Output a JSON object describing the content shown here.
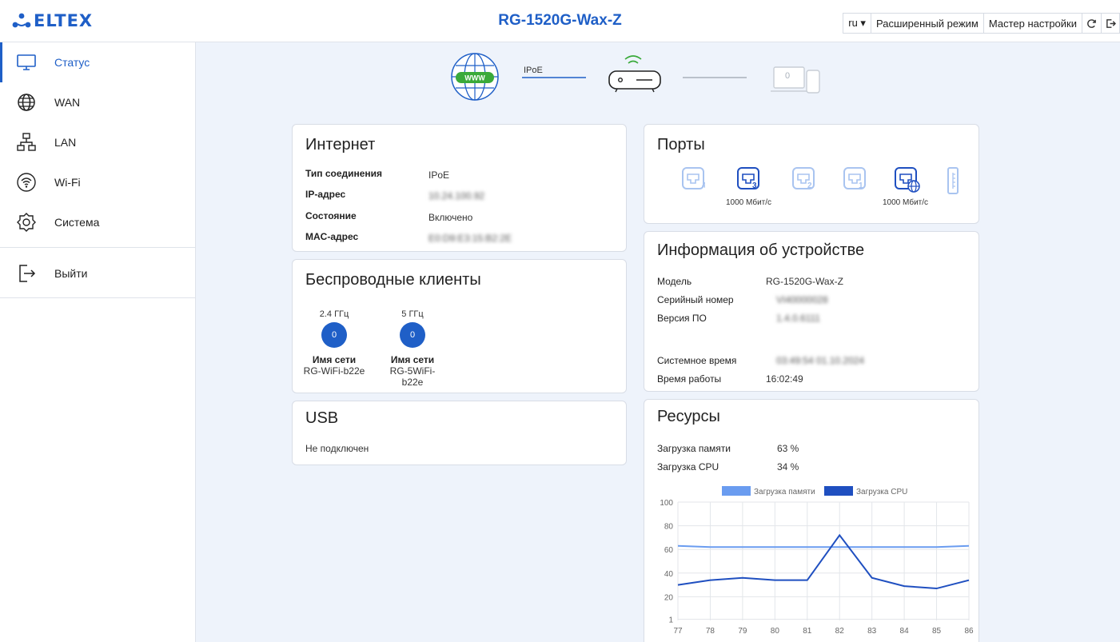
{
  "header": {
    "logo": "ELTEX",
    "title": "RG-1520G-Wax-Z",
    "lang": "ru ▾",
    "advanced_mode": "Расширенный режим",
    "setup_wizard": "Мастер настройки",
    "refresh_icon": "refresh-icon",
    "logout_icon": "logout-icon"
  },
  "sidebar": {
    "items": [
      {
        "label": "Статус",
        "icon": "monitor-icon",
        "active": true
      },
      {
        "label": "WAN",
        "icon": "globe-icon"
      },
      {
        "label": "LAN",
        "icon": "network-icon"
      },
      {
        "label": "Wi-Fi",
        "icon": "wifi-icon"
      },
      {
        "label": "Система",
        "icon": "gear-icon"
      },
      {
        "label": "Выйти",
        "icon": "logout-icon"
      }
    ]
  },
  "topology": {
    "www_label": "WWW",
    "link_label": "IPoE",
    "clients_count": "0"
  },
  "internet": {
    "title": "Интернет",
    "rows": [
      {
        "key": "Тип соединения",
        "value": "IPoE"
      },
      {
        "key": "IP-адрес",
        "value": "10.24.100.92"
      },
      {
        "key": "Состояние",
        "value": "Включено"
      },
      {
        "key": "MAC-адрес",
        "value": "E0:D9:E3:15:B2:2E"
      }
    ]
  },
  "wireless": {
    "title": "Беспроводные клиенты",
    "bands": [
      {
        "band": "2.4 ГГц",
        "count": "0",
        "net_label": "Имя сети",
        "ssid": "RG-WiFi-b22e"
      },
      {
        "band": "5 ГГц",
        "count": "0",
        "net_label": "Имя сети",
        "ssid": "RG-5WiFi-b22e"
      }
    ]
  },
  "usb": {
    "title": "USB",
    "status": "Не подключен"
  },
  "ports": {
    "title": "Порты",
    "items": [
      {
        "num": "4",
        "active": false,
        "speed": ""
      },
      {
        "num": "3",
        "active": true,
        "speed": "1000 Мбит/с"
      },
      {
        "num": "2",
        "active": false,
        "speed": ""
      },
      {
        "num": "1",
        "active": false,
        "speed": ""
      },
      {
        "num": "WAN",
        "active": true,
        "speed": "1000 Мбит/с"
      }
    ]
  },
  "device": {
    "title": "Информация об устройстве",
    "rows": [
      {
        "key": "Модель",
        "value": "RG-1520G-Wax-Z"
      },
      {
        "key": "Серийный номер",
        "value": "VI40000028"
      },
      {
        "key": "Версия ПО",
        "value": "1.4.0.6111"
      },
      {
        "key": "Системное время",
        "value": "03:49:54 01.10.2024"
      },
      {
        "key": "Время работы",
        "value": "16:02:49"
      }
    ]
  },
  "resources": {
    "title": "Ресурсы",
    "rows": [
      {
        "key": "Загрузка памяти",
        "value": "63 %"
      },
      {
        "key": "Загрузка CPU",
        "value": "34 %"
      }
    ]
  },
  "colors": {
    "accent": "#1f5fc7",
    "memory_series": "#6a9cf0",
    "cpu_series": "#1f4fc0",
    "port_inactive": "#a9c4f0"
  },
  "chart_data": {
    "type": "line",
    "x": [
      77,
      78,
      79,
      80,
      81,
      82,
      83,
      84,
      85,
      86
    ],
    "series": [
      {
        "name": "Загрузка памяти",
        "values": [
          63,
          62,
          62,
          62,
          62,
          62,
          62,
          62,
          62,
          63
        ]
      },
      {
        "name": "Загрузка CPU",
        "values": [
          30,
          34,
          36,
          34,
          34,
          72,
          36,
          29,
          27,
          34
        ]
      }
    ],
    "ylim": [
      1,
      100
    ],
    "yticks": [
      1,
      20,
      40,
      60,
      80,
      100
    ],
    "legend": "top",
    "grid": true
  }
}
